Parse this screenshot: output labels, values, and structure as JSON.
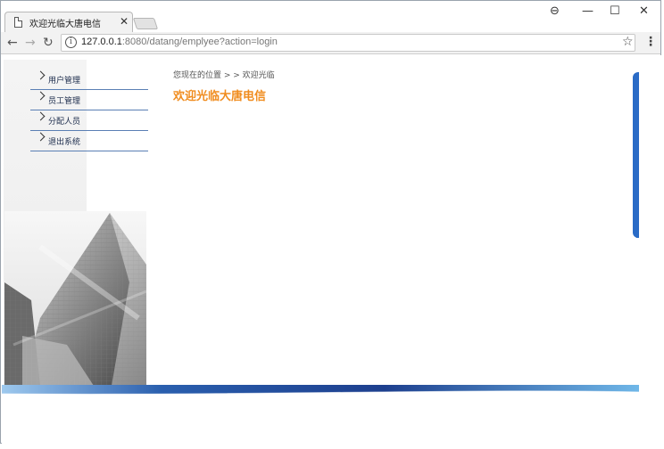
{
  "browser": {
    "tab_title": "欢迎光临大唐电信",
    "tab_close": "×",
    "address_host": "127.0.0.1",
    "address_path": ":8080/datang/emplyee?action=login",
    "controls": {
      "account": "⊖",
      "minimize": "—",
      "maximize": "☐",
      "close": "✕",
      "back": "←",
      "forward": "→",
      "reload": "↻",
      "star": "☆",
      "menu": "⋮",
      "info": "i"
    }
  },
  "sidebar": {
    "items": [
      {
        "label": "用户管理"
      },
      {
        "label": "员工管理"
      },
      {
        "label": "分配人员"
      },
      {
        "label": "退出系统"
      }
    ]
  },
  "main": {
    "breadcrumb": "您现在的位置 > > 欢迎光临",
    "welcome": "欢迎光临大唐电信"
  },
  "colors": {
    "accent_orange": "#f08c1e",
    "nav_line": "#5a7fb4",
    "brand_blue": "#2a6bc6"
  }
}
